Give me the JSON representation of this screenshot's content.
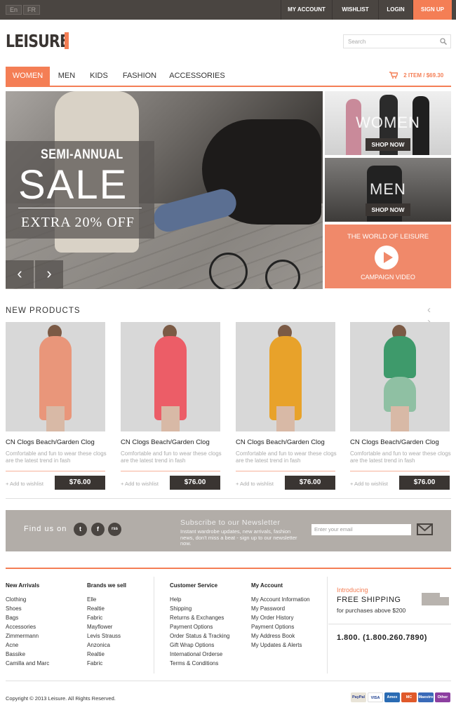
{
  "topbar": {
    "languages": [
      "En",
      "FR"
    ],
    "links": [
      "MY ACCOUNT",
      "WISHLIST",
      "LOGIN",
      "SIGN UP"
    ]
  },
  "header": {
    "logo": "LEISURE",
    "search_placeholder": "Search"
  },
  "nav": {
    "items": [
      "WOMEN",
      "MEN",
      "KIDS",
      "FASHION",
      "ACCESSORIES"
    ],
    "cart_items": "2 ITEM",
    "cart_total": "$69.30"
  },
  "hero": {
    "semi": "SEMI-ANNUAL",
    "sale": "SALE",
    "extra": "EXTRA 20% OFF",
    "prev": "‹",
    "next": "›"
  },
  "side_banners": {
    "women_label": "WOMEN",
    "men_label": "MEN",
    "shop_now": "SHOP NOW",
    "world": "THE WORLD OF LEISURE",
    "campaign": "CAMPAIGN VIDEO"
  },
  "new_products": {
    "title": "NEW PRODUCTS",
    "arrows": "‹ ›",
    "items": [
      {
        "name": "CN Clogs Beach/Garden Clog",
        "desc": "Comfortable and fun to wear these clogs are the latest trend in fash",
        "wishlist": "+ Add to wishlist",
        "price": "$76.00"
      },
      {
        "name": "CN Clogs Beach/Garden Clog",
        "desc": "Comfortable and fun to wear these clogs are the latest trend in fash",
        "wishlist": "+ Add to wishlist",
        "price": "$76.00"
      },
      {
        "name": "CN Clogs Beach/Garden Clog",
        "desc": "Comfortable and fun to wear these clogs are the latest trend in fash",
        "wishlist": "+ Add to wishlist",
        "price": "$76.00"
      },
      {
        "name": "CN Clogs Beach/Garden Clog",
        "desc": "Comfortable and fun to wear these clogs are the latest trend in fash",
        "wishlist": "+ Add to wishlist",
        "price": "$76.00"
      }
    ]
  },
  "follow": {
    "find_us": "Find us on",
    "social": [
      "t",
      "f",
      "rss"
    ],
    "newsletter_title": "Subscribe to our Newsletter",
    "newsletter_desc": "Instant wardrobe updates, new arrivals, fashion news, don't miss a beat - sign up to our newsletter now.",
    "email_placeholder": "Enter your email"
  },
  "footer": {
    "columns": [
      {
        "title": "New Arrivals",
        "items": [
          "Clothing",
          "Shoes",
          "Bags",
          "Accessories",
          "Zimmermann",
          "Acne",
          "Bassike",
          "Camilla and Marc"
        ]
      },
      {
        "title": "Brands we sell",
        "items": [
          "Elle",
          "Realtie",
          "Fabric",
          "Mayflower",
          "Levis Strauss",
          "Anzonica",
          "Realtie",
          "Fabric"
        ]
      },
      {
        "title": "Customer Service",
        "items": [
          "Help",
          "Shipping",
          "Returns & Exchanges",
          "Payment Options",
          "Order Status & Tracking",
          "Gift Wrap Options",
          "International Orderse",
          "Terms & Conditions"
        ]
      },
      {
        "title": "My Account",
        "items": [
          "My Account Information",
          "My Password",
          "My Order History",
          "Payment Options",
          "My Address Book",
          "My Updates & Alerts"
        ]
      }
    ],
    "introducing": "Introducing",
    "free_shipping": "FREE SHIPPING",
    "purchases": "for purchases above $200",
    "phone": "1.800. (1.800.260.7890)",
    "copyright": "Copyright © 2013 Leisure. All Rights Reserved.",
    "cards": [
      "PayPal",
      "VISA",
      "Amex",
      "MC",
      "Maestro",
      "Other"
    ]
  },
  "colors": {
    "accent": "#f47e55",
    "dark": "#4a4541",
    "follow_bg": "#b2ada8"
  }
}
